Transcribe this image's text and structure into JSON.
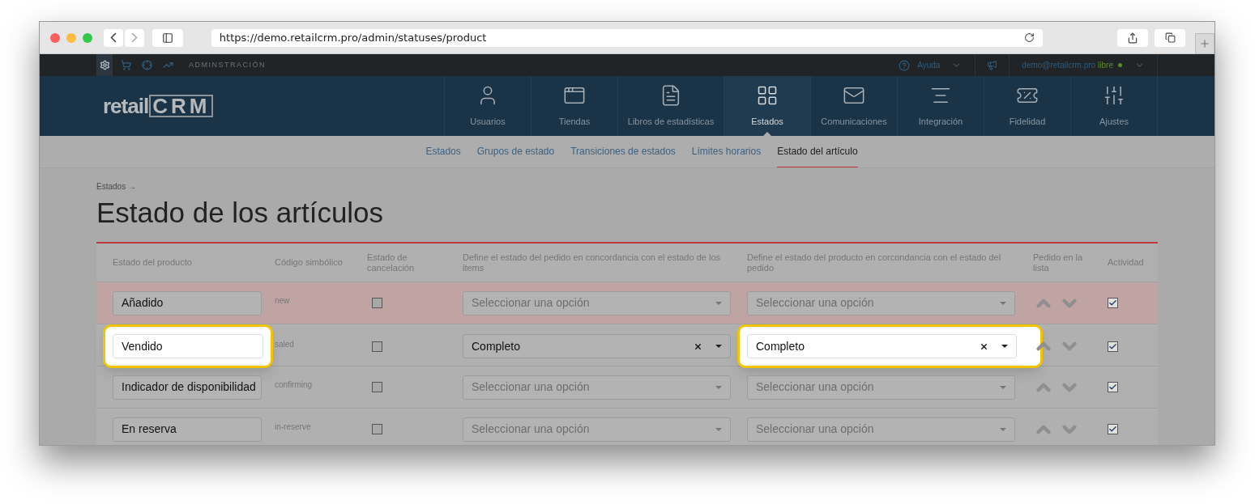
{
  "browser": {
    "url": "https://demo.retailcrm.pro/admin/statuses/product"
  },
  "top_bar": {
    "section_icons": [
      {
        "kind": "gear",
        "selected": true
      },
      {
        "kind": "cart",
        "selected": false
      },
      {
        "kind": "crosshair",
        "selected": false
      },
      {
        "kind": "chart",
        "selected": false
      }
    ],
    "section_label": "ADMINSTRACIÓN",
    "help": "Ayuda",
    "user_email": "demo@retailcrm.pro",
    "plan": "libre"
  },
  "logo": {
    "word": "retail",
    "letters": "CRM"
  },
  "nav": [
    {
      "label": "Usuarios",
      "selected": false
    },
    {
      "label": "Tiendas",
      "selected": false
    },
    {
      "label": "Libros de estadísticas",
      "selected": false
    },
    {
      "label": "Estados",
      "selected": true
    },
    {
      "label": "Comunicaciones",
      "selected": false
    },
    {
      "label": "Integración",
      "selected": false
    },
    {
      "label": "Fidelidad",
      "selected": false
    },
    {
      "label": "Ajustes",
      "selected": false
    }
  ],
  "subnav": [
    {
      "label": "Estados",
      "selected": false
    },
    {
      "label": "Grupos de estado",
      "selected": false
    },
    {
      "label": "Transiciones de estados",
      "selected": false
    },
    {
      "label": "Límites horarios",
      "selected": false
    },
    {
      "label": "Estado del artículo",
      "selected": true
    }
  ],
  "breadcrumb": "Estados →",
  "title": "Estado de los artículos",
  "table": {
    "columns": [
      "Estado del producto",
      "Código simbólico",
      "Estado de cancelación",
      "Define el estado del pedido en concordancia con el estado de los items",
      "Define el estado del producto en corcondancia con el estado del pedido",
      "Pedido en la lista",
      "Actividad"
    ],
    "rows": [
      {
        "name": "Añadido",
        "name_highlighted": false,
        "code": "new",
        "cancel": false,
        "order_status": {
          "placeholder": "Seleccionar una opción",
          "highlighted": false
        },
        "product_status": {
          "placeholder": "Seleccionar una opción",
          "highlighted": false
        },
        "active": true,
        "hovered": true
      },
      {
        "name": "Vendido",
        "name_highlighted": true,
        "code": "saled",
        "cancel": false,
        "order_status": {
          "value": "Completo",
          "highlighted": false
        },
        "product_status": {
          "value": "Completo",
          "highlighted": true
        },
        "active": true,
        "hovered": false
      },
      {
        "name": "Indicador de disponibilidad",
        "name_highlighted": false,
        "code": "confirming",
        "cancel": false,
        "order_status": {
          "placeholder": "Seleccionar una opción",
          "highlighted": false
        },
        "product_status": {
          "placeholder": "Seleccionar una opción",
          "highlighted": false
        },
        "active": true,
        "hovered": false
      },
      {
        "name": "En reserva",
        "name_highlighted": false,
        "code": "in-reserve",
        "cancel": false,
        "order_status": {
          "placeholder": "Seleccionar una opción",
          "highlighted": false
        },
        "product_status": {
          "placeholder": "Seleccionar una opción",
          "highlighted": false
        },
        "active": true,
        "hovered": false
      }
    ]
  }
}
